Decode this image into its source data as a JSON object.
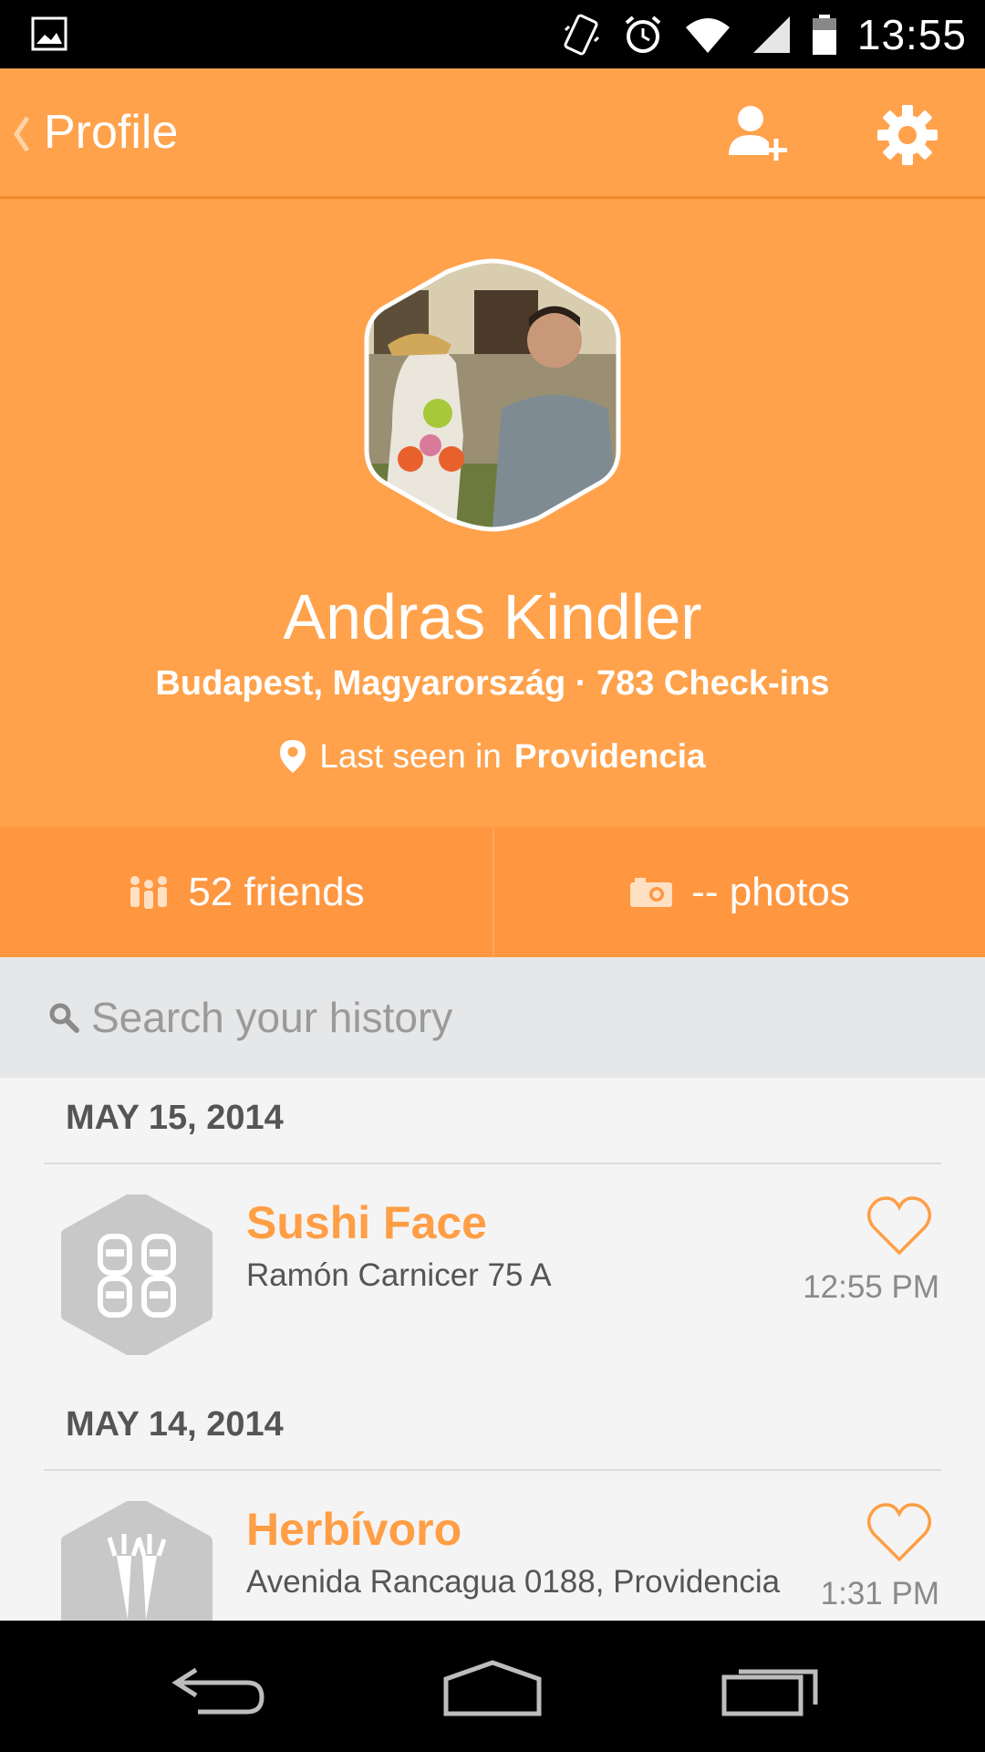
{
  "status_bar": {
    "time": "13:55",
    "icons": [
      "gallery-notification-icon",
      "vibrate-icon",
      "alarm-icon",
      "wifi-icon",
      "signal-icon",
      "battery-icon"
    ]
  },
  "appbar": {
    "back_icon": "chevron-left-icon",
    "title": "Profile",
    "actions": [
      "add-friend-icon",
      "settings-gear-icon"
    ],
    "background": "#ffa24b"
  },
  "profile": {
    "name": "Andras Kindler",
    "subline": "Budapest, Magyarország · 783 Check-ins",
    "last_seen_prefix": "Last seen in",
    "last_seen_place": "Providencia"
  },
  "stats": {
    "friends_count": "52",
    "friends_label": "friends",
    "photos_count": "--",
    "photos_label": "photos",
    "background": "#ff9640"
  },
  "search": {
    "placeholder": "Search your history"
  },
  "history": [
    {
      "date": "MAY 15, 2014",
      "venue": "Sushi Face",
      "address": "Ramón Carnicer 75 A",
      "time": "12:55 PM",
      "category_icon": "sushi-icon"
    },
    {
      "date": "MAY 14, 2014",
      "venue": "Herbívoro",
      "address": "Avenida Rancagua 0188, Providencia",
      "time": "1:31 PM",
      "category_icon": "vegetables-icon"
    }
  ],
  "accent_color": "#ff9e45",
  "navbar": {
    "buttons": [
      "back-nav-icon",
      "home-nav-icon",
      "recents-nav-icon"
    ]
  }
}
